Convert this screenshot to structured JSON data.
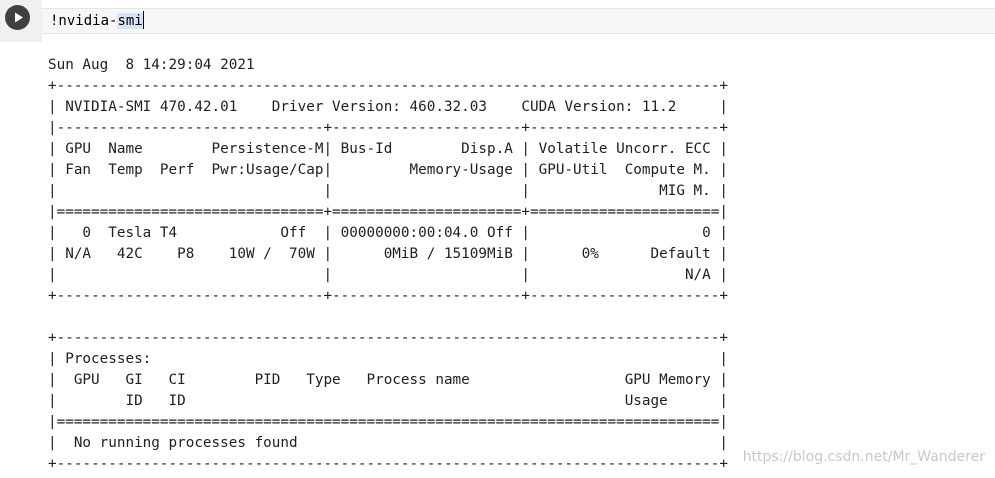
{
  "cell": {
    "run_icon": "play-icon",
    "code_prefix": "!nvidia-",
    "code_selected": "smi"
  },
  "output": {
    "lines": [
      "Sun Aug  8 14:29:04 2021",
      "+-----------------------------------------------------------------------------+",
      "| NVIDIA-SMI 470.42.01    Driver Version: 460.32.03    CUDA Version: 11.2     |",
      "|-------------------------------+----------------------+----------------------+",
      "| GPU  Name        Persistence-M| Bus-Id        Disp.A | Volatile Uncorr. ECC |",
      "| Fan  Temp  Perf  Pwr:Usage/Cap|         Memory-Usage | GPU-Util  Compute M. |",
      "|                               |                      |               MIG M. |",
      "|===============================+======================+======================|",
      "|   0  Tesla T4            Off  | 00000000:00:04.0 Off |                    0 |",
      "| N/A   42C    P8    10W /  70W |      0MiB / 15109MiB |      0%      Default |",
      "|                               |                      |                  N/A |",
      "+-------------------------------+----------------------+----------------------+",
      "",
      "+-----------------------------------------------------------------------------+",
      "| Processes:                                                                  |",
      "|  GPU   GI   CI        PID   Type   Process name                  GPU Memory |",
      "|        ID   ID                                                   Usage      |",
      "|=============================================================================|",
      "|  No running processes found                                                 |",
      "+-----------------------------------------------------------------------------+"
    ]
  },
  "watermark": "https://blog.csdn.net/Mr_Wanderer"
}
